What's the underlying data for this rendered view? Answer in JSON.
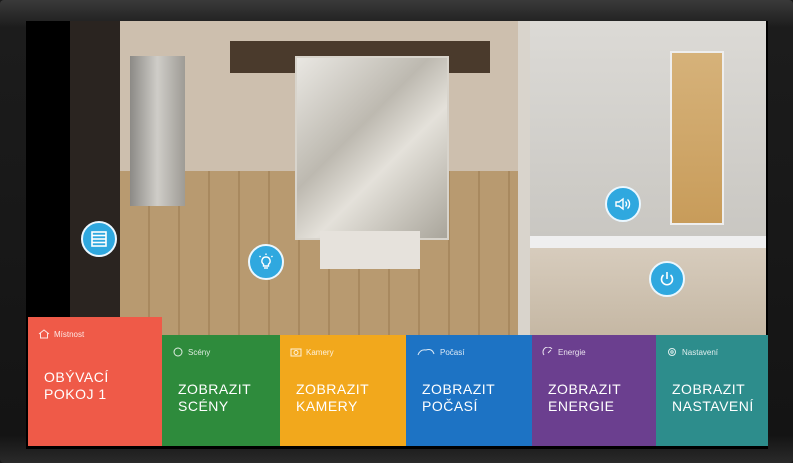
{
  "controls": {
    "blinds_icon": "blinds-icon",
    "light_icon": "bulb-icon",
    "volume_icon": "speaker-icon",
    "power_icon": "power-icon"
  },
  "tiles": [
    {
      "header": "Místnost",
      "line1": "OBÝVACÍ",
      "line2": "POKOJ 1",
      "color": "#ef5a48",
      "icon": "house-icon"
    },
    {
      "header": "Scény",
      "line1": "ZOBRAZIT",
      "line2": "SCÉNY",
      "color": "#2e8b3c",
      "icon": "scene-icon"
    },
    {
      "header": "Kamery",
      "line1": "ZOBRAZIT",
      "line2": "KAMERY",
      "color": "#f2a81c",
      "icon": "camera-icon"
    },
    {
      "header": "Počasí",
      "line1": "ZOBRAZIT",
      "line2": "POČASÍ",
      "color": "#1d73c4",
      "icon": "weather-icon"
    },
    {
      "header": "Energie",
      "line1": "ZOBRAZIT",
      "line2": "ENERGIE",
      "color": "#6b3f8f",
      "icon": "energy-icon"
    },
    {
      "header": "Nastavení",
      "line1": "ZOBRAZIT",
      "line2": "NASTAVENÍ",
      "color": "#2d8d8c",
      "icon": "gear-icon"
    }
  ]
}
